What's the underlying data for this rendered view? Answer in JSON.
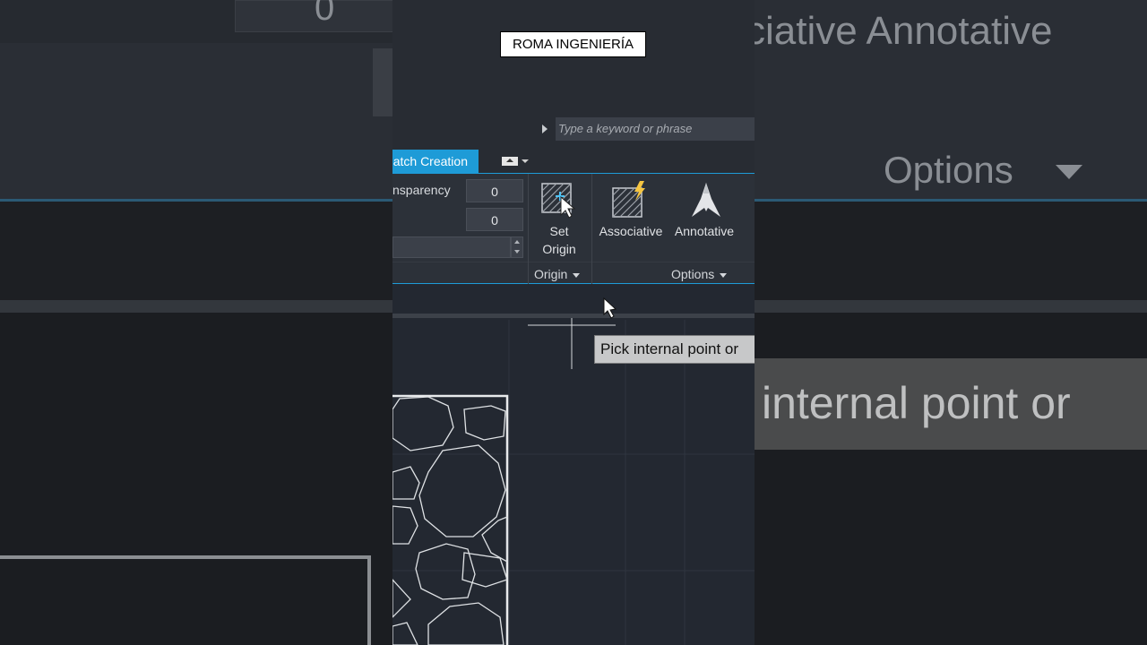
{
  "branding": {
    "watermark": "ROMA INGENIERÍA"
  },
  "search": {
    "placeholder": "Type a keyword or phrase"
  },
  "ribbon": {
    "active_tab": "atch Creation",
    "properties": {
      "transparency_label": "nsparency",
      "transparency_value": "0",
      "angle_value": "0"
    },
    "origin": {
      "set_origin_label_1": "Set",
      "set_origin_label_2": "Origin",
      "group_label": "Origin"
    },
    "options": {
      "associative_label": "Associative",
      "annotative_label": "Annotative",
      "group_label": "Options"
    }
  },
  "command_prompt": {
    "tooltip": "Pick internal point or"
  },
  "background_zoom": {
    "top_value": "0",
    "ribbon_text": "ciative  Annotative",
    "options_text": "Options",
    "tooltip_left": "internal point or"
  },
  "colors": {
    "accent": "#1e9bd7",
    "background": "#282c33",
    "canvas": "#232831"
  },
  "icons": [
    "set-origin-icon",
    "associative-icon",
    "annotative-icon",
    "cursor-arrow-icon",
    "crosshair-icon"
  ]
}
